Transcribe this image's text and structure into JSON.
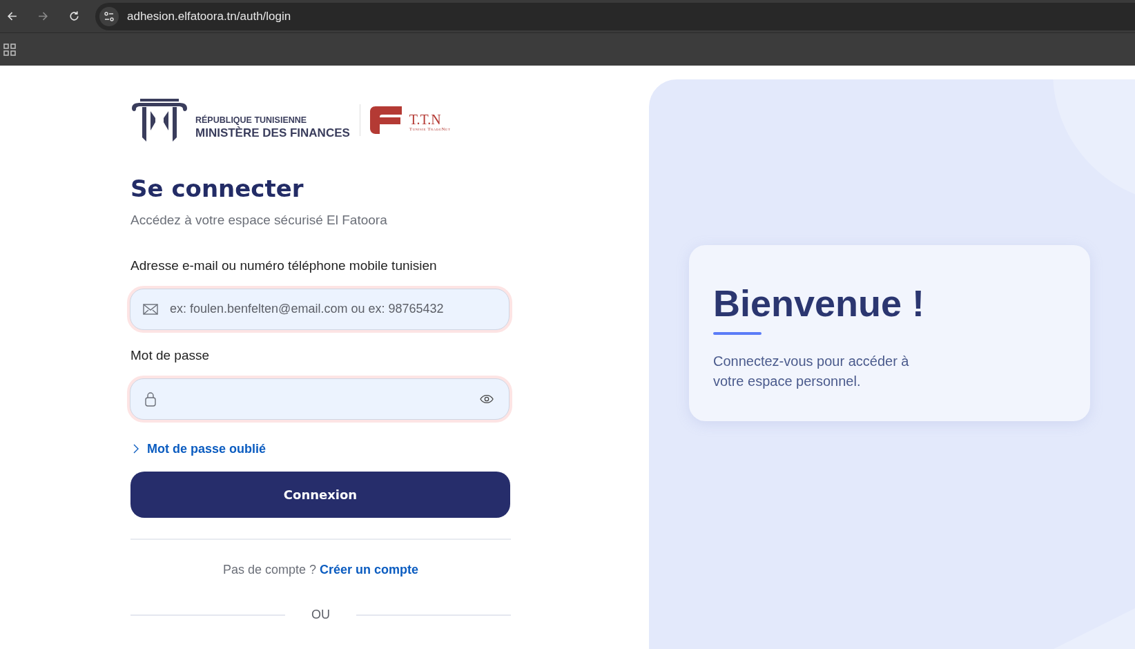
{
  "browser": {
    "url": "adhesion.elfatoora.tn/auth/login"
  },
  "logos": {
    "ministry_line_1": "RÉPUBLIQUE TUNISIENNE",
    "ministry_line_2": "MINISTÈRE DES FINANCES",
    "partner_mark": "T.T.N",
    "partner_name": "Tunisie TradeNet"
  },
  "login": {
    "title": "Se connecter",
    "subtitle": "Accédez à votre espace sécurisé El Fatoora",
    "fields": [
      {
        "kind": "email",
        "label": "Adresse e-mail ou numéro téléphone mobile tunisien",
        "placeholder": "ex: foulen.benfelten@email.com ou ex: 98765432",
        "error": true
      },
      {
        "kind": "password",
        "label": "Mot de passe",
        "error": true
      }
    ],
    "forgot_link": "Mot de passe oublié",
    "submit": "Connexion",
    "signup_prompt": "Pas de compte ?",
    "signup_link": "Créer un compte",
    "separator": "OU"
  },
  "welcome": {
    "title": "Bienvenue !",
    "text": "Connectez-vous pour accéder à votre espace personnel."
  }
}
